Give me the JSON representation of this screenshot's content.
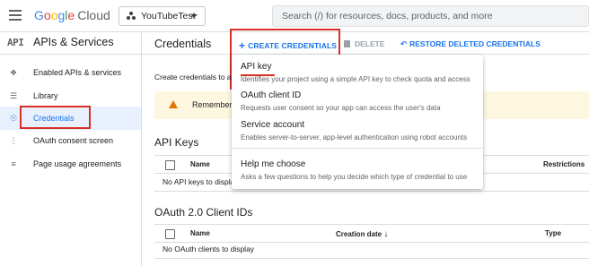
{
  "topbar": {
    "logo_letters": [
      "G",
      "o",
      "o",
      "g",
      "l",
      "e"
    ],
    "logo_product": "Cloud",
    "project_name": "YouTubeTest",
    "search_placeholder": "Search (/) for resources, docs, products, and more"
  },
  "sidebar": {
    "title": "APIs & Services",
    "items": [
      {
        "label": "Enabled APIs & services",
        "icon": "diamond-api-icon"
      },
      {
        "label": "Library",
        "icon": "library-icon"
      },
      {
        "label": "Credentials",
        "icon": "key-icon",
        "active": true
      },
      {
        "label": "OAuth consent screen",
        "icon": "consent-icon"
      },
      {
        "label": "Page usage agreements",
        "icon": "settings-list-icon"
      }
    ]
  },
  "main": {
    "title": "Credentials",
    "actions": {
      "create": "CREATE CREDENTIALS",
      "delete": "DELETE",
      "restore": "RESTORE DELETED CREDENTIALS"
    },
    "description": "Create credentials to ac",
    "banner_text": "Remember to",
    "api_keys": {
      "title": "API Keys",
      "columns": [
        "Name",
        "Restrictions"
      ],
      "empty": "No API keys to displa"
    },
    "oauth": {
      "title": "OAuth 2.0 Client IDs",
      "columns": [
        "Name",
        "Creation date",
        "Type"
      ],
      "empty": "No OAuth clients to display"
    }
  },
  "dropdown": {
    "items": [
      {
        "title": "API key",
        "subtitle": "Identifies your project using a simple API key to check quota and access"
      },
      {
        "title": "OAuth client ID",
        "subtitle": "Requests user consent so your app can access the user's data"
      },
      {
        "title": "Service account",
        "subtitle": "Enables server-to-server, app-level authentication using robot accounts"
      },
      {
        "title": "Help me choose",
        "subtitle": "Asks a few questions to help you decide which type of credential to use"
      }
    ]
  },
  "colors": {
    "accent": "#1a73e8",
    "highlight_box": "#d93025",
    "warning": "#e37400",
    "active_bg": "#e8f0fe"
  }
}
